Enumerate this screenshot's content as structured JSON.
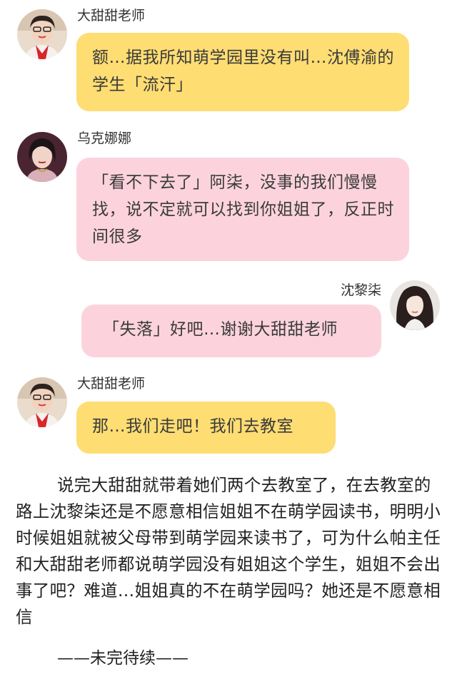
{
  "messages": [
    {
      "sender": "大甜甜老师",
      "text": "额…据我所知萌学园里没有叫…沈傅渝的学生「流汗」"
    },
    {
      "sender": "乌克娜娜",
      "text": "「看不下去了」阿柒，没事的我们慢慢找，说不定就可以找到你姐姐了，反正时间很多"
    },
    {
      "sender": "沈黎柒",
      "text": "「失落」好吧…谢谢大甜甜老师"
    },
    {
      "sender": "大甜甜老师",
      "text": "那…我们走吧！我们去教室"
    }
  ],
  "narration": "说完大甜甜就带着她们两个去教室了，在去教室的路上沈黎柒还是不愿意相信姐姐不在萌学园读书，明明小时候姐姐就被父母带到萌学园来读书了，可为什么帕主任和大甜甜老师都说萌学园没有姐姐这个学生，姐姐不会出事了吧？难道…姐姐真的不在萌学园吗？她还是不愿意相信",
  "footer": "——未完待续——",
  "colors": {
    "yellow_bubble": "#fedd73",
    "pink_bubble": "#fcd3dd"
  }
}
